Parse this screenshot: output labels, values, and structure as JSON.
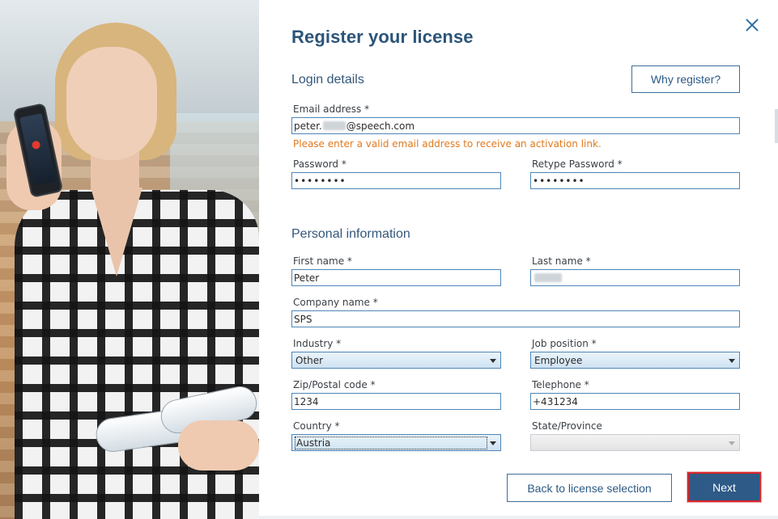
{
  "dialog": {
    "title": "Register your license",
    "close_label": "×"
  },
  "login": {
    "heading": "Login details",
    "why_button": "Why register?",
    "email_label": "Email address *",
    "email_prefix": "peter.",
    "email_suffix": "@speech.com",
    "email_hint": "Please enter a valid email address to receive an activation link.",
    "password_label": "Password *",
    "password_value": "••••••••",
    "retype_label": "Retype Password *",
    "retype_value": "••••••••"
  },
  "personal": {
    "heading": "Personal information",
    "first_name_label": "First name *",
    "first_name_value": "Peter",
    "last_name_label": "Last name *",
    "company_label": "Company name *",
    "company_value": "SPS",
    "industry_label": "Industry *",
    "industry_value": "Other",
    "job_label": "Job position *",
    "job_value": "Employee",
    "zip_label": "Zip/Postal code *",
    "zip_value": "1234",
    "phone_label": "Telephone *",
    "phone_value": "+431234",
    "country_label": "Country *",
    "country_value": "Austria",
    "state_label": "State/Province",
    "state_value": ""
  },
  "footer": {
    "back_button": "Back to license selection",
    "next_button": "Next"
  },
  "colors": {
    "accent": "#2d5a86",
    "title": "#2c5478",
    "hint": "#e07a1f",
    "focus_border": "#d9262b"
  }
}
